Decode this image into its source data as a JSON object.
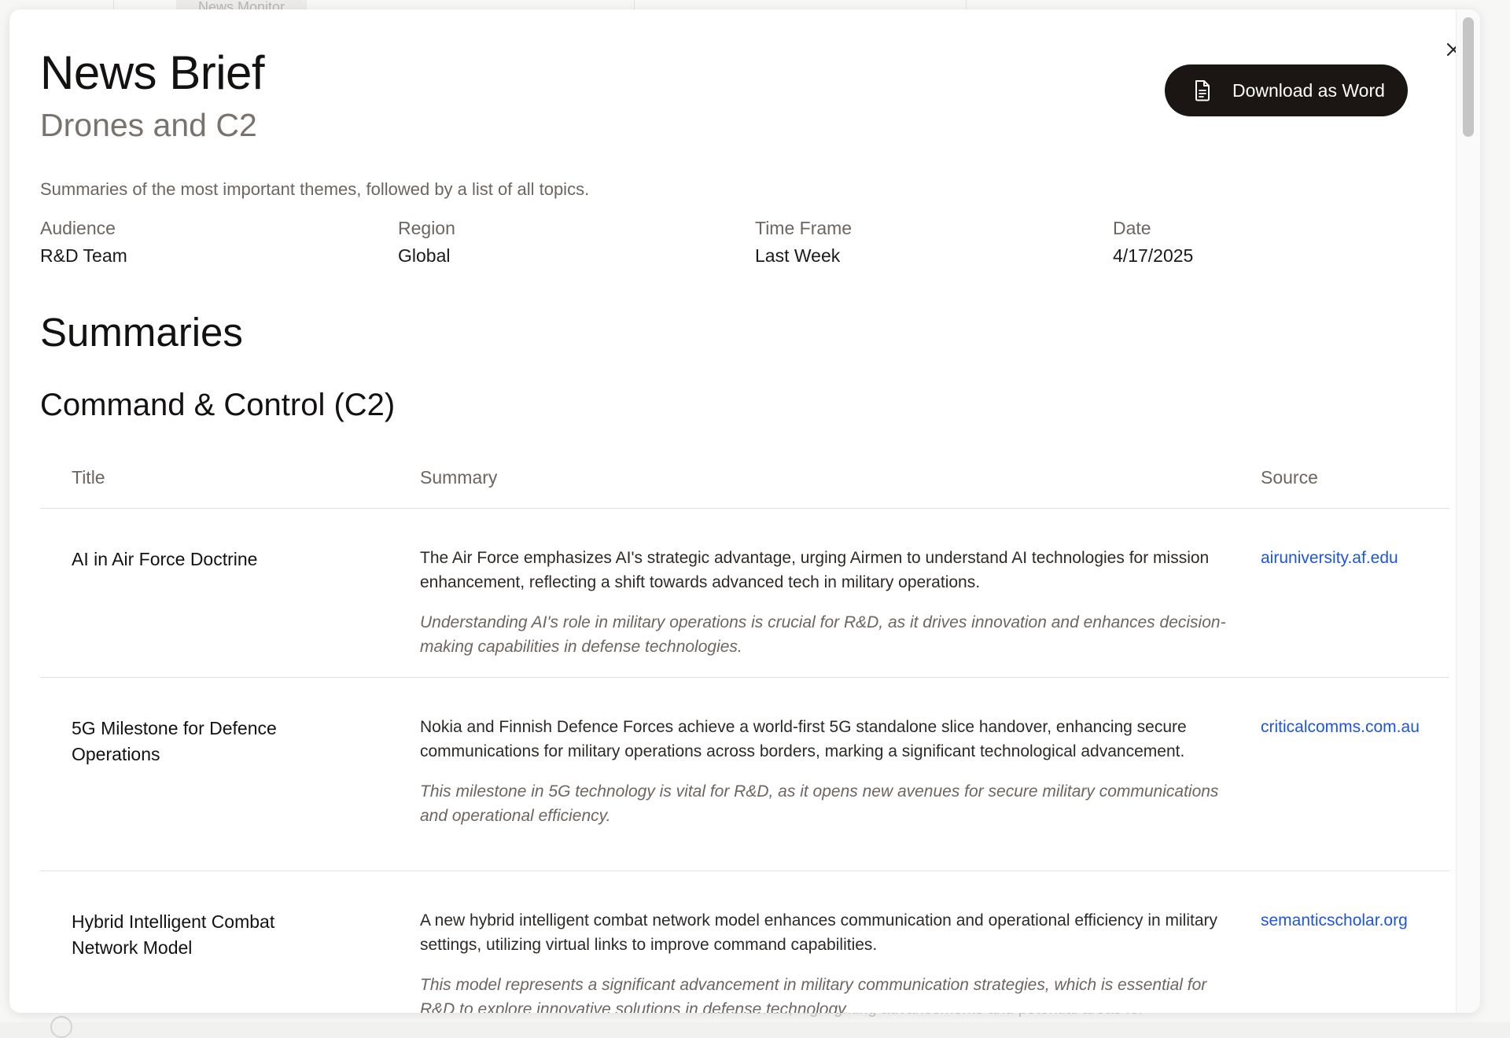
{
  "background": {
    "tab_label": "News Monitor",
    "footer_fragment": "future trends, highlighting advancements and potential areas for"
  },
  "modal": {
    "title": "News Brief",
    "subtitle": "Drones and C2",
    "download_label": "Download as Word",
    "close_icon": "close-icon",
    "description": "Summaries of the most important themes, followed by a list of all topics.",
    "meta": [
      {
        "label": "Audience",
        "value": "R&D Team"
      },
      {
        "label": "Region",
        "value": "Global"
      },
      {
        "label": "Time Frame",
        "value": "Last Week"
      },
      {
        "label": "Date",
        "value": "4/17/2025"
      }
    ]
  },
  "summaries": {
    "heading": "Summaries",
    "groups": [
      {
        "heading": "Command & Control (C2)",
        "columns": {
          "title": "Title",
          "summary": "Summary",
          "source": "Source"
        },
        "rows": [
          {
            "title": "AI in Air Force Doctrine",
            "summary": "The Air Force emphasizes AI's strategic advantage, urging Airmen to understand AI technologies for mission enhancement, reflecting a shift towards advanced tech in military operations.",
            "insight": "Understanding AI's role in military operations is crucial for R&D, as it drives innovation and enhances decision-making capabilities in defense technologies.",
            "source": "airuniversity.af.edu"
          },
          {
            "title": "5G Milestone for Defence Operations",
            "summary": "Nokia and Finnish Defence Forces achieve a world-first 5G standalone slice handover, enhancing secure communications for military operations across borders, marking a significant technological advancement.",
            "insight": "This milestone in 5G technology is vital for R&D, as it opens new avenues for secure military communications and operational efficiency.",
            "source": "criticalcomms.com.au"
          },
          {
            "title": "Hybrid Intelligent Combat Network Model",
            "summary": "A new hybrid intelligent combat network model enhances communication and operational efficiency in military settings, utilizing virtual links to improve command capabilities.",
            "insight": "This model represents a significant advancement in military communication strategies, which is essential for R&D to explore innovative solutions in defense technology.",
            "source": "semanticscholar.org"
          }
        ]
      }
    ]
  }
}
